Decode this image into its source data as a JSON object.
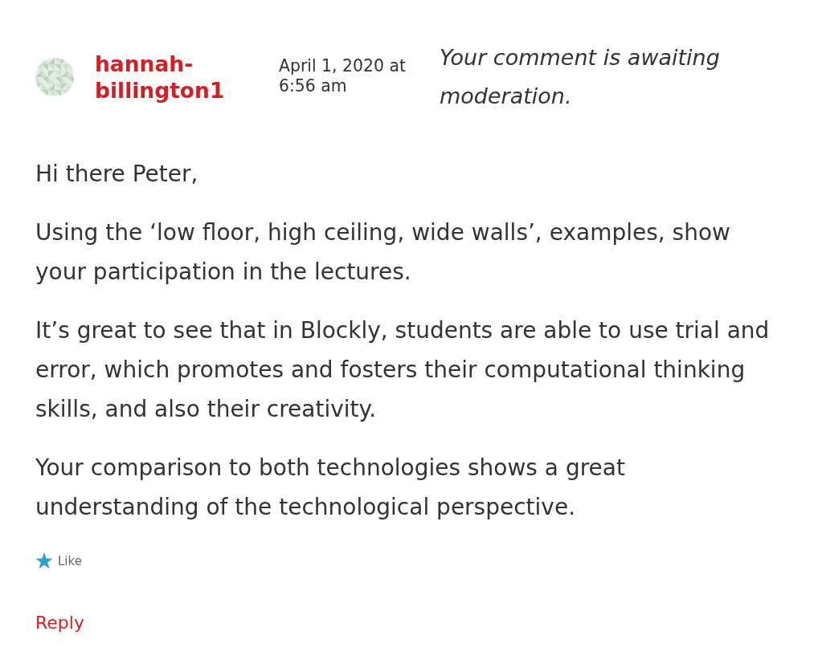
{
  "comment": {
    "author": "hannah-billington1",
    "date": "April 1, 2020 at 6:56 am",
    "moderation_note": "Your comment is awaiting moderation.",
    "paragraphs": [
      "Hi there Peter,",
      "Using the ‘low floor, high ceiling, wide walls’, examples, show your participation in the lectures.",
      "It’s great to see that in Blockly, students are able to use trial and error, which promotes and fosters their computational thinking skills, and also their creativity.",
      "Your comparison to both technologies shows a great understanding of the technological perspective."
    ]
  },
  "like_button": {
    "label": "Like"
  },
  "reply_link": {
    "label": "Reply"
  }
}
